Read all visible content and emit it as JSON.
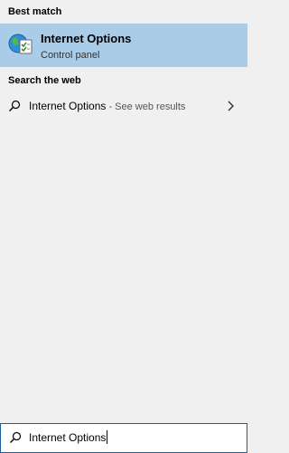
{
  "best_match": {
    "header": "Best match",
    "title": "Internet Options",
    "subtitle": "Control panel",
    "icon": "internet-options-icon"
  },
  "web": {
    "header": "Search the web",
    "result_text": "Internet Options",
    "separator": " - ",
    "result_hint": "See web results",
    "icon": "search-icon"
  },
  "search": {
    "value": "Internet Options",
    "icon": "search-icon"
  },
  "colors": {
    "selected_bg": "#a9cde8",
    "panel_bg": "#f0f0f0",
    "search_border": "#1e5f9e"
  }
}
